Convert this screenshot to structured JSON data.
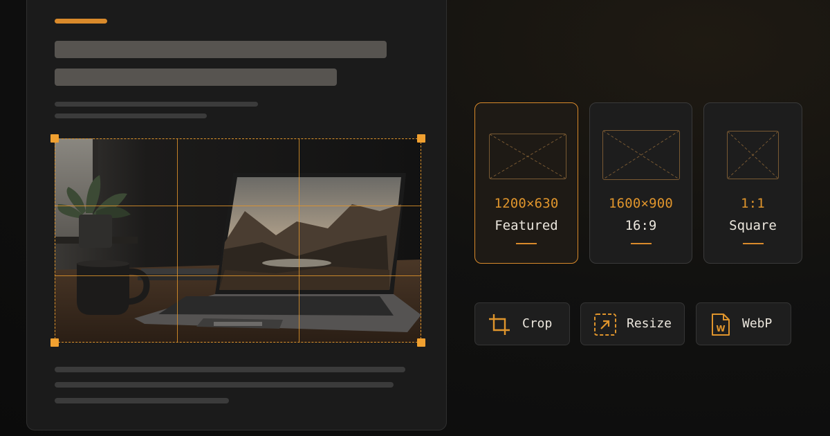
{
  "presets": [
    {
      "dims": "1200×630",
      "label": "Featured",
      "active": true
    },
    {
      "dims": "1600×900",
      "label": "16:9",
      "active": false
    },
    {
      "dims": "1:1",
      "label": "Square",
      "active": false
    }
  ],
  "actions": [
    {
      "label": "Crop",
      "icon": "crop-icon"
    },
    {
      "label": "Resize",
      "icon": "resize-icon"
    },
    {
      "label": "WebP",
      "icon": "webp-file-icon"
    }
  ],
  "webp_icon_letter": "W",
  "colors": {
    "accent": "#d98a2b",
    "background": "#111110",
    "card": "#1d1d1d"
  }
}
